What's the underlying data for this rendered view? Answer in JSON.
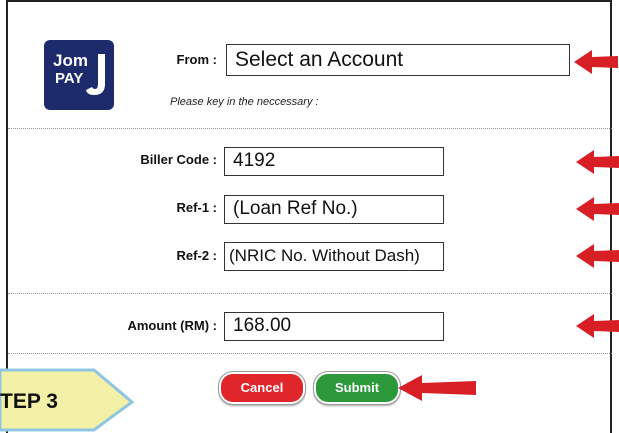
{
  "logo": {
    "line1": "Jom",
    "line2": "PAY"
  },
  "from": {
    "label": "From :",
    "value": "Select an Account"
  },
  "hint": "Please key in the neccessary :",
  "biller_code": {
    "label": "Biller Code :",
    "value": "4192"
  },
  "ref1": {
    "label": "Ref-1 :",
    "value": "(Loan Ref No.)"
  },
  "ref2": {
    "label": "Ref-2 :",
    "value": "(NRIC No. Without Dash)"
  },
  "amount": {
    "label": "Amount (RM) :",
    "value": "168.00"
  },
  "buttons": {
    "cancel": "Cancel",
    "submit": "Submit"
  },
  "step": {
    "label": "TEP 3"
  },
  "colors": {
    "logo_bg": "#1d2a6b",
    "arrow": "#d81f26",
    "cancel": "#e0262b",
    "submit": "#2c9a3a",
    "step_bg": "#f3f0a8",
    "step_border": "#8fc5e0"
  }
}
